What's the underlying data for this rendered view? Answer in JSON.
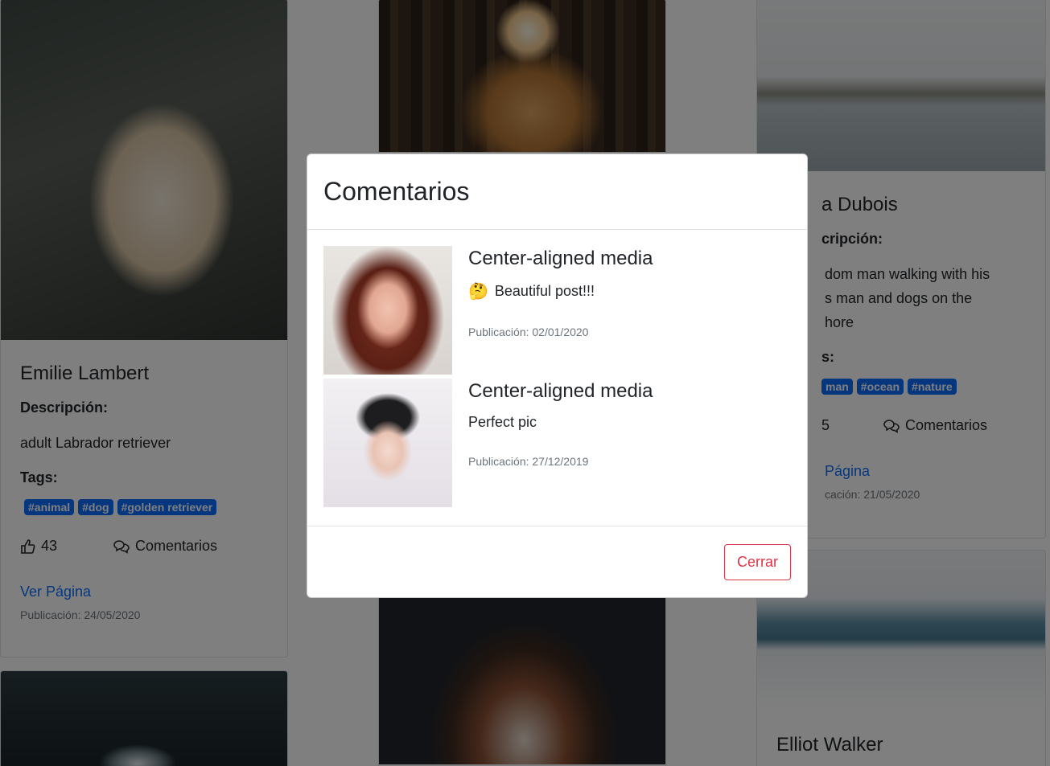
{
  "cards": {
    "emilie": {
      "name": "Emilie Lambert",
      "desc_label": "Descripción:",
      "desc": "adult Labrador retriever",
      "tags_label": "Tags:",
      "tags": [
        "#animal",
        "#dog",
        "#golden retriever"
      ],
      "likes": "43",
      "comments_label": "Comentarios",
      "page_link": "Ver Página",
      "pub": "Publicación: 24/05/2020"
    },
    "dubois": {
      "name": "a Dubois",
      "desc_label": "cripción:",
      "desc_line1": "dom man walking with his",
      "desc_line2": "s man and dogs on the",
      "desc_line3": "hore",
      "tags_label": "s:",
      "tags": [
        "man",
        "#ocean",
        "#nature"
      ],
      "likes": "5",
      "comments_label": "Comentarios",
      "page_link": "Página",
      "pub": "cación: 21/05/2020"
    },
    "elliot": {
      "name": "Elliot Walker"
    }
  },
  "modal": {
    "title": "Comentarios",
    "comments": [
      {
        "title": "Center-aligned media",
        "emoji": "🤔",
        "text": "Beautiful post!!!",
        "pub": "Publicación: 02/01/2020"
      },
      {
        "title": "Center-aligned media",
        "text": "Perfect pic",
        "pub": "Publicación: 27/12/2019"
      }
    ],
    "close_label": "Cerrar"
  },
  "colors": {
    "primary": "#0d6efd",
    "danger": "#dc3545",
    "muted": "#6c757d"
  }
}
